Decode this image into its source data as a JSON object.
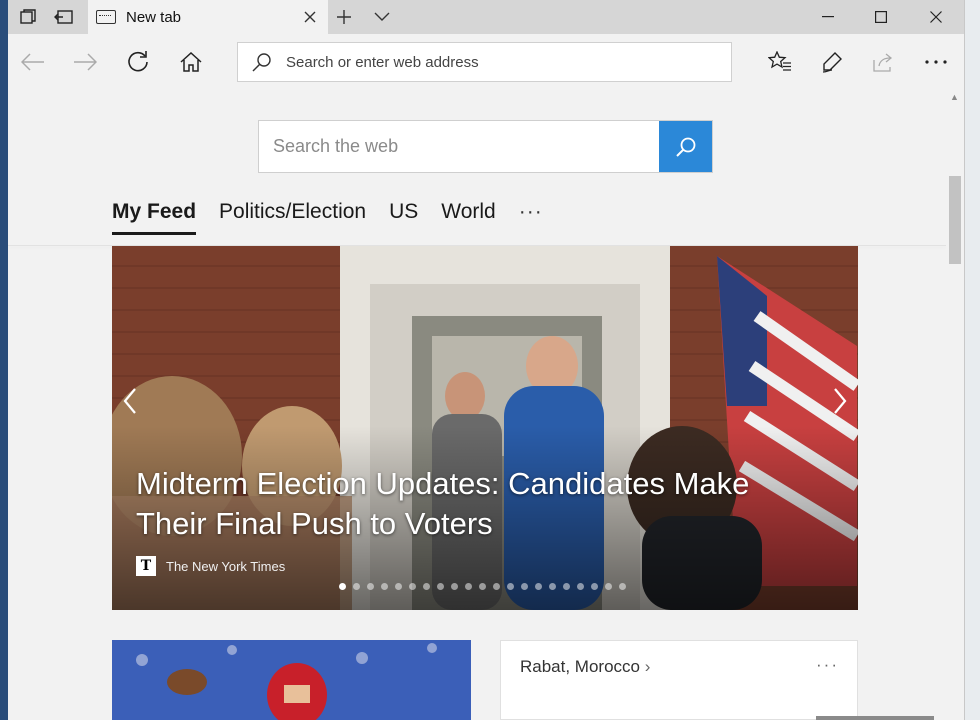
{
  "browser": {
    "tab_title": "New tab",
    "address_placeholder": "Search or enter web address"
  },
  "page": {
    "search_placeholder": "Search the web",
    "feed_tabs": [
      {
        "label": "My Feed",
        "active": true
      },
      {
        "label": "Politics/Election",
        "active": false
      },
      {
        "label": "US",
        "active": false
      },
      {
        "label": "World",
        "active": false
      }
    ],
    "more_tabs": "···",
    "hero": {
      "title": "Midterm Election Updates: Candidates Make Their Final Push to Voters",
      "source": "The New York Times",
      "source_logo": "T",
      "slide_count": 21,
      "active_slide": 0
    },
    "weather": {
      "location": "Rabat, Morocco",
      "more": "···"
    }
  },
  "colors": {
    "accent": "#2b88d8",
    "chrome": "#d6d6d6",
    "background": "#f2f2f2"
  }
}
